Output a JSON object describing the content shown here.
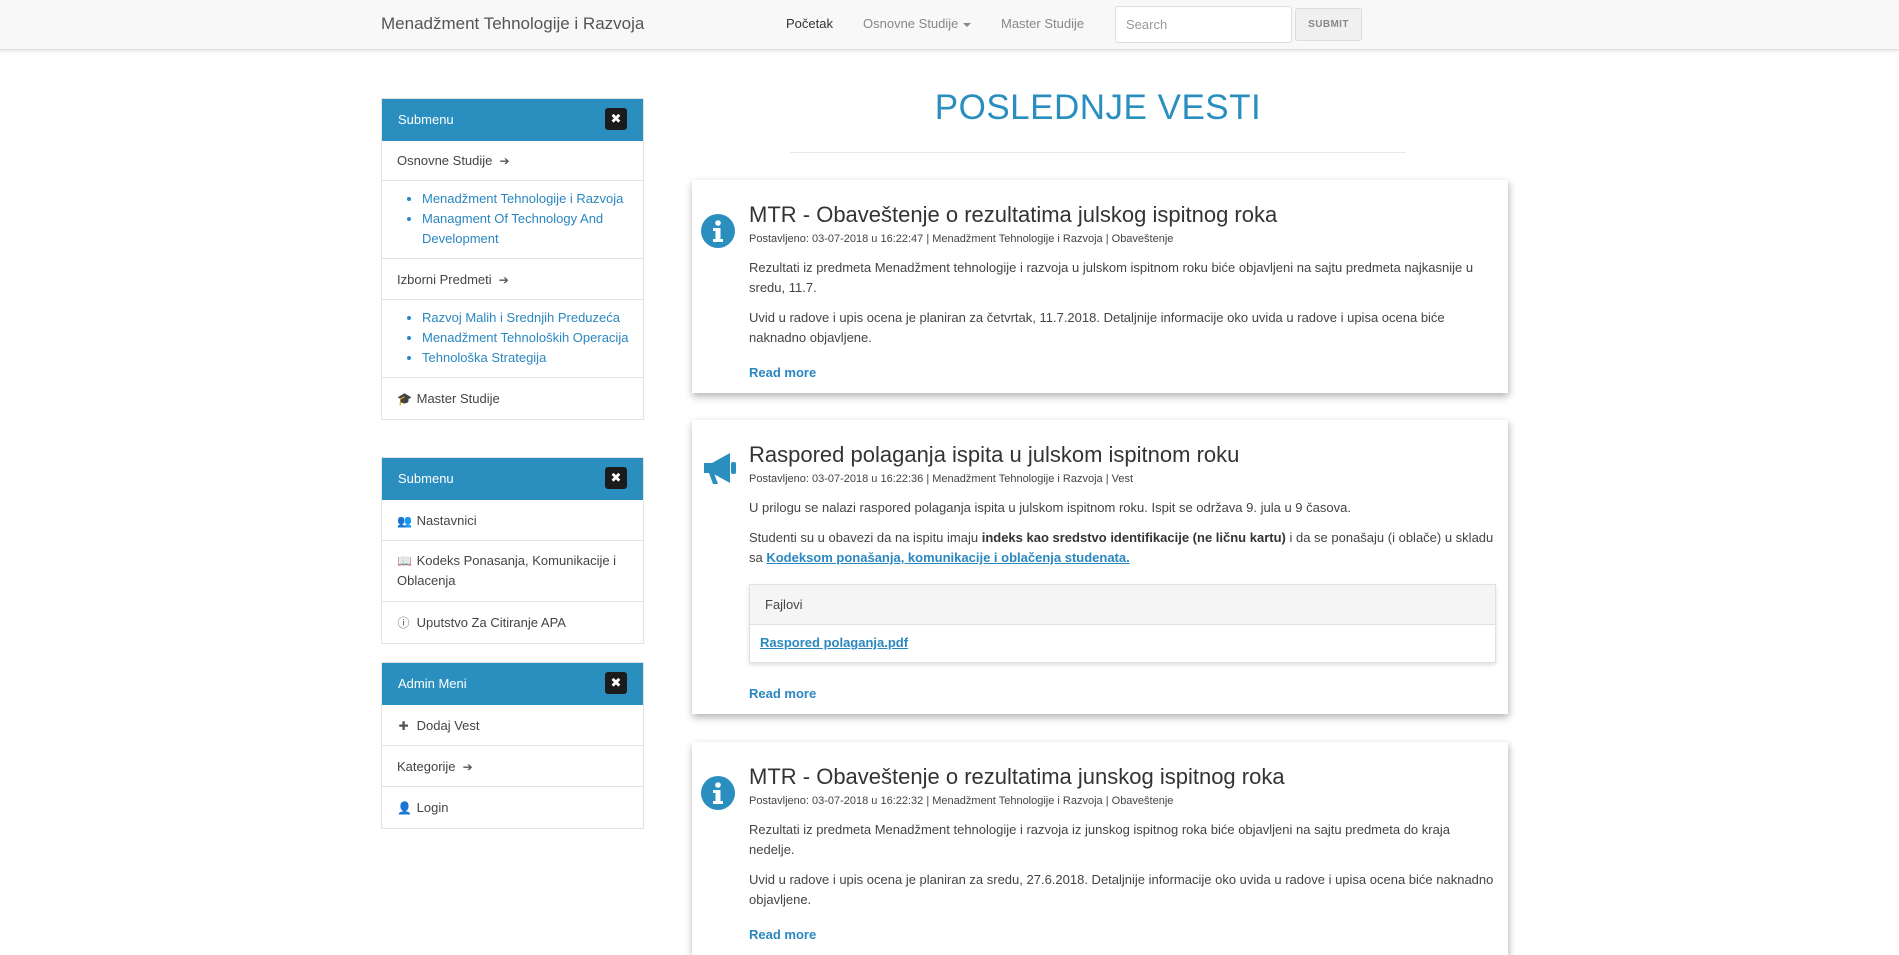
{
  "navbar": {
    "brand": "Menadžment Tehnologije i Razvoja",
    "links": [
      {
        "label": "Početak"
      },
      {
        "label": "Osnovne Studije"
      },
      {
        "label": "Master Studije"
      }
    ],
    "search_placeholder": "Search",
    "submit_label": "SUBMIT"
  },
  "sidebar": {
    "panels": [
      {
        "heading": "Submenu",
        "close_icon": "times-icon",
        "sections": [
          {
            "label": "Osnovne Studije",
            "icon": "arrow-right-icon",
            "links": [
              "Menadžment Tehnologije i Razvoja",
              "Managment Of Technology And Development"
            ]
          },
          {
            "label": "Izborni Predmeti",
            "icon": "arrow-right-icon",
            "links": [
              "Razvoj Malih i Srednjih Preduzeća",
              "Menadžment Tehnoloških Operacija",
              "Tehnološka Strategija"
            ]
          },
          {
            "label": "Master Studije",
            "icon": "graduation-cap-icon"
          }
        ]
      },
      {
        "heading": "Submenu",
        "close_icon": "times-icon",
        "items": [
          {
            "label": "Nastavnici",
            "icon": "users-icon"
          },
          {
            "label": "Kodeks Ponasanja, Komunikacije i Oblacenja",
            "icon": "book-icon"
          },
          {
            "label": "Uputstvo Za Citiranje APA",
            "icon": "info-circle-icon"
          }
        ]
      },
      {
        "heading": "Admin Meni",
        "close_icon": "times-icon",
        "items": [
          {
            "label": "Dodaj Vest",
            "icon": "plus-icon"
          },
          {
            "label": "Kategorije",
            "icon": "arrow-right-icon"
          },
          {
            "label": "Login",
            "icon": "user-icon"
          }
        ]
      }
    ]
  },
  "main": {
    "heading": "POSLEDNJE VESTI",
    "news": [
      {
        "icon": "info-circle-icon",
        "title": "MTR - Obaveštenje o rezultatima julskog ispitnog roka",
        "meta": "Postavljeno:  03-07-2018 u 16:22:47 | Menadžment Tehnologije i Razvoja | Obaveštenje",
        "paragraphs": [
          "Rezultati iz predmeta Menadžment tehnologije i razvoja u julskom ispitnom roku biće objavljeni na sajtu predmeta najkasnije u sredu, 11.7.",
          "Uvid u radove i upis ocena je planiran za četvrtak, 11.7.2018. Detaljnije informacije oko uvida u radove i upisa ocena biće naknadno objavljene."
        ],
        "read_more": "Read more"
      },
      {
        "icon": "bullhorn-icon",
        "title": "Raspored polaganja ispita u julskom ispitnom roku",
        "meta": "Postavljeno:  03-07-2018 u 16:22:36 | Menadžment Tehnologije i Razvoja | Vest",
        "p1": "U prilogu se nalazi raspored polaganja ispita u julskom ispitnom roku. Ispit se održava 9. jula u 9 časova.",
        "p2_start": "Studenti su u obavezi da na ispitu imaju ",
        "p2_bold": "indeks kao sredstvo identifikacije (ne ličnu kartu)",
        "p2_mid": " i da se ponašaju (i oblače) u skladu sa ",
        "p2_link": "Kodeksom ponašanja, komunikacije i oblačenja studenata.",
        "files_heading": "Fajlovi",
        "file_link": "Raspored polaganja.pdf",
        "read_more": "Read more"
      },
      {
        "icon": "info-circle-icon",
        "title": "MTR - Obaveštenje o rezultatima junskog ispitnog roka",
        "meta": "Postavljeno:  03-07-2018 u 16:22:32 | Menadžment Tehnologije i Razvoja | Obaveštenje",
        "paragraphs": [
          "Rezultati iz predmeta Menadžment tehnologije i razvoja iz junskog ispitnog roka biće objavljeni na sajtu predmeta do kraja nedelje.",
          "Uvid u radove i upis ocena je planiran za sredu, 27.6.2018. Detaljnije informacije oko uvida u radove i upisa ocena biće naknadno objavljene."
        ],
        "read_more": "Read more"
      }
    ]
  },
  "colors": {
    "accent": "#2a8fbf",
    "link": "#2a87c0",
    "panel_heading": "#2a8fbf",
    "close_button": "#1b1b1b"
  }
}
